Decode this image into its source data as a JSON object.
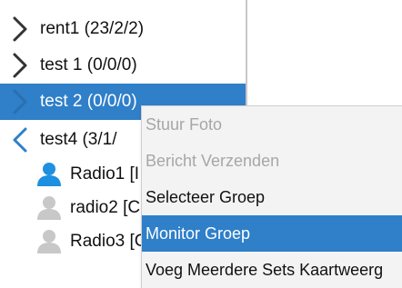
{
  "tree": {
    "groups": [
      {
        "label": "rent1 (23/2/2)",
        "expanded": false,
        "selected": false
      },
      {
        "label": "test 1 (0/0/0)",
        "expanded": false,
        "selected": false
      },
      {
        "label": "test 2 (0/0/0)",
        "expanded": false,
        "selected": true
      },
      {
        "label": "test4 (3/1/",
        "expanded": true,
        "selected": false
      }
    ],
    "children": [
      {
        "label": "Radio1 [I",
        "status": "online",
        "icon": "user-online-icon"
      },
      {
        "label": "radio2 [C",
        "status": "offline",
        "icon": "user-offline-icon"
      },
      {
        "label": "Radio3 [C",
        "status": "offline",
        "icon": "user-offline-icon"
      }
    ]
  },
  "context_menu": {
    "items": [
      {
        "label": "Stuur Foto",
        "enabled": false
      },
      {
        "label": "Bericht Verzenden",
        "enabled": false
      },
      {
        "label": "Selecteer Groep",
        "enabled": true
      },
      {
        "label": "Monitor Groep",
        "enabled": true,
        "highlighted": true
      },
      {
        "label": "Voeg Meerdere Sets Kaartweerg",
        "enabled": true
      }
    ]
  },
  "colors": {
    "selection": "#2f7fc9",
    "chevron_collapsed": "#333333",
    "chevron_expanded": "#2f7fc9",
    "online_user": "#1e90e0",
    "offline_user": "#c8c8c8"
  }
}
